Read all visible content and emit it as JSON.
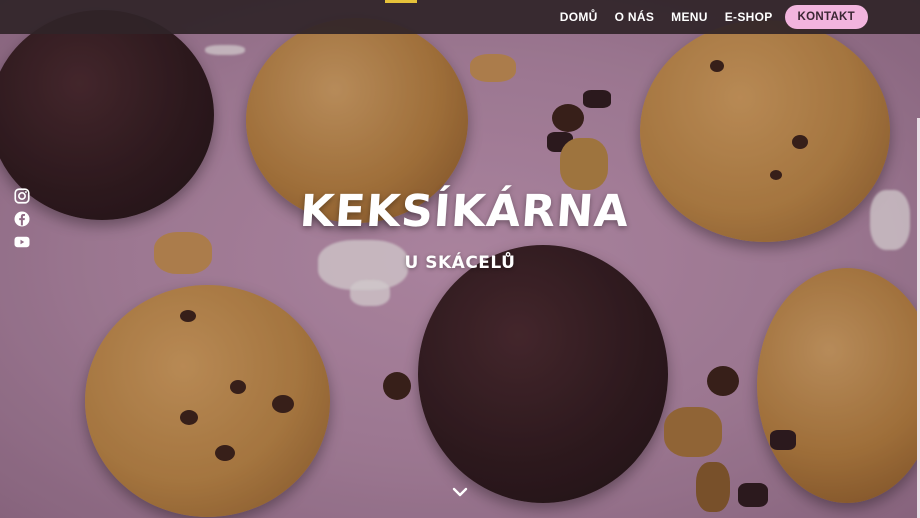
{
  "nav": {
    "items": [
      {
        "label": "DOMŮ"
      },
      {
        "label": "O NÁS"
      },
      {
        "label": "MENU"
      },
      {
        "label": "E-SHOP"
      }
    ],
    "cta_label": "KONTAKT"
  },
  "hero": {
    "title": "KEKSÍKÁRNA",
    "subtitle": "U SKÁCELŮ"
  },
  "social": {
    "icons": [
      "instagram-icon",
      "facebook-icon",
      "youtube-icon"
    ]
  },
  "colors": {
    "background": "#b48aa8",
    "navbar": "#302428",
    "cta": "#f2b4de",
    "text": "#ffffff"
  }
}
